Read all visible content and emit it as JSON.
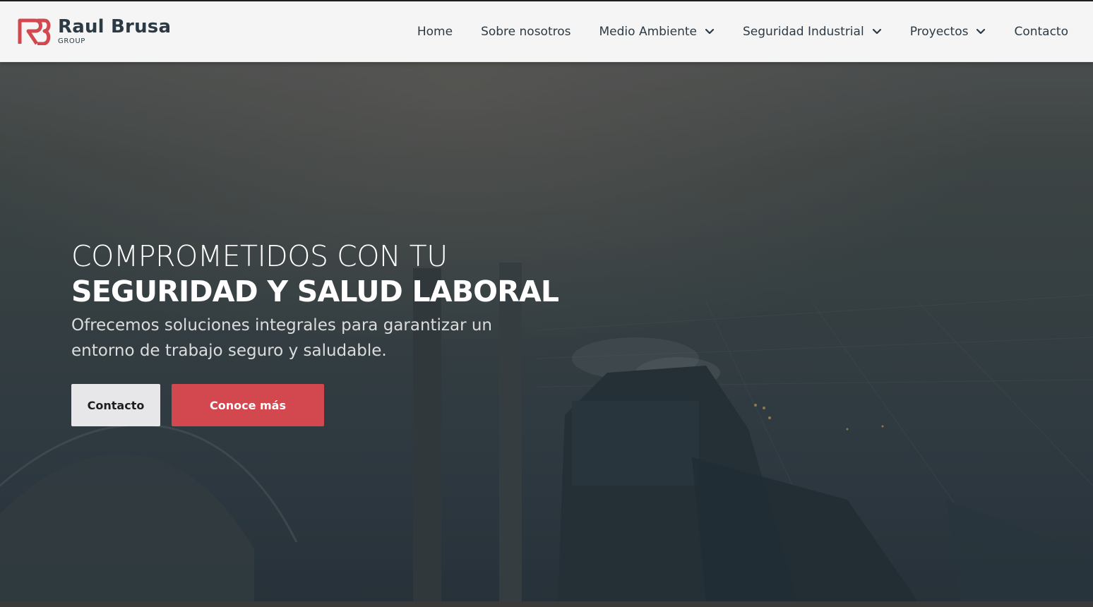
{
  "header": {
    "brand_name": "Raul Brusa",
    "brand_sub": "GROUP",
    "menu": [
      {
        "label": "Home",
        "has_dropdown": false
      },
      {
        "label": "Sobre nosotros",
        "has_dropdown": false
      },
      {
        "label": "Medio Ambiente",
        "has_dropdown": true
      },
      {
        "label": "Seguridad Industrial",
        "has_dropdown": true
      },
      {
        "label": "Proyectos",
        "has_dropdown": true
      },
      {
        "label": "Contacto",
        "has_dropdown": false
      }
    ]
  },
  "hero": {
    "title_line1": "COMPROMETIDOS CON TU",
    "title_line2": "SEGURIDAD Y SALUD LABORAL",
    "subtitle": "Ofrecemos soluciones integrales para garantizar un entorno de trabajo seguro y saludable.",
    "primary_button": "Contacto",
    "secondary_button": "Conoce más"
  },
  "icons": {
    "logo": "rb-logo-icon",
    "dropdown": "chevron-down-icon"
  },
  "colors": {
    "brand_red": "#d3474f",
    "nav_text": "#2b3a44",
    "nav_bg": "#f5f5f5",
    "light_button": "#e7e7e9"
  }
}
